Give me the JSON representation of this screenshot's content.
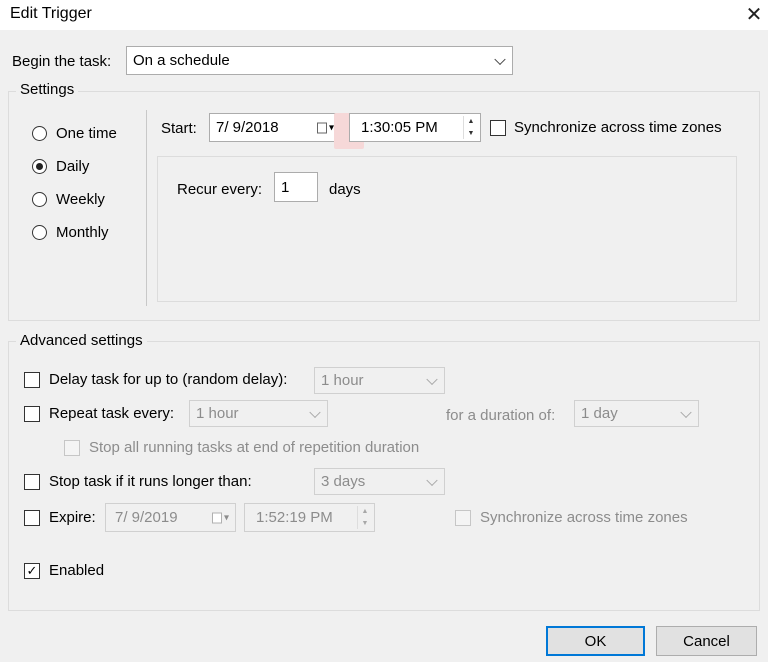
{
  "window": {
    "title": "Edit Trigger"
  },
  "begin_task": {
    "label": "Begin the task:",
    "value": "On a schedule"
  },
  "settings": {
    "group_label": "Settings",
    "radios": [
      {
        "label": "One time",
        "selected": false
      },
      {
        "label": "Daily",
        "selected": true
      },
      {
        "label": "Weekly",
        "selected": false
      },
      {
        "label": "Monthly",
        "selected": false
      }
    ],
    "start_label": "Start:",
    "start_date": "7/  9/2018",
    "start_time": "1:30:05 PM",
    "sync_label": "Synchronize across time zones",
    "recur_label": "Recur every:",
    "recur_value": "1",
    "recur_unit": "days"
  },
  "advanced": {
    "group_label": "Advanced settings",
    "delay_label": "Delay task for up to (random delay):",
    "delay_value": "1 hour",
    "repeat_label": "Repeat task every:",
    "repeat_value": "1 hour",
    "duration_label": "for a duration of:",
    "duration_value": "1 day",
    "stop_all_label": "Stop all running tasks at end of repetition duration",
    "stop_longer_label": "Stop task if it runs longer than:",
    "stop_longer_value": "3 days",
    "expire_label": "Expire:",
    "expire_date": "7/  9/2019",
    "expire_time": "1:52:19 PM",
    "expire_sync_label": "Synchronize across time zones",
    "enabled_label": "Enabled",
    "enabled_checked": true
  },
  "buttons": {
    "ok": "OK",
    "cancel": "Cancel"
  }
}
